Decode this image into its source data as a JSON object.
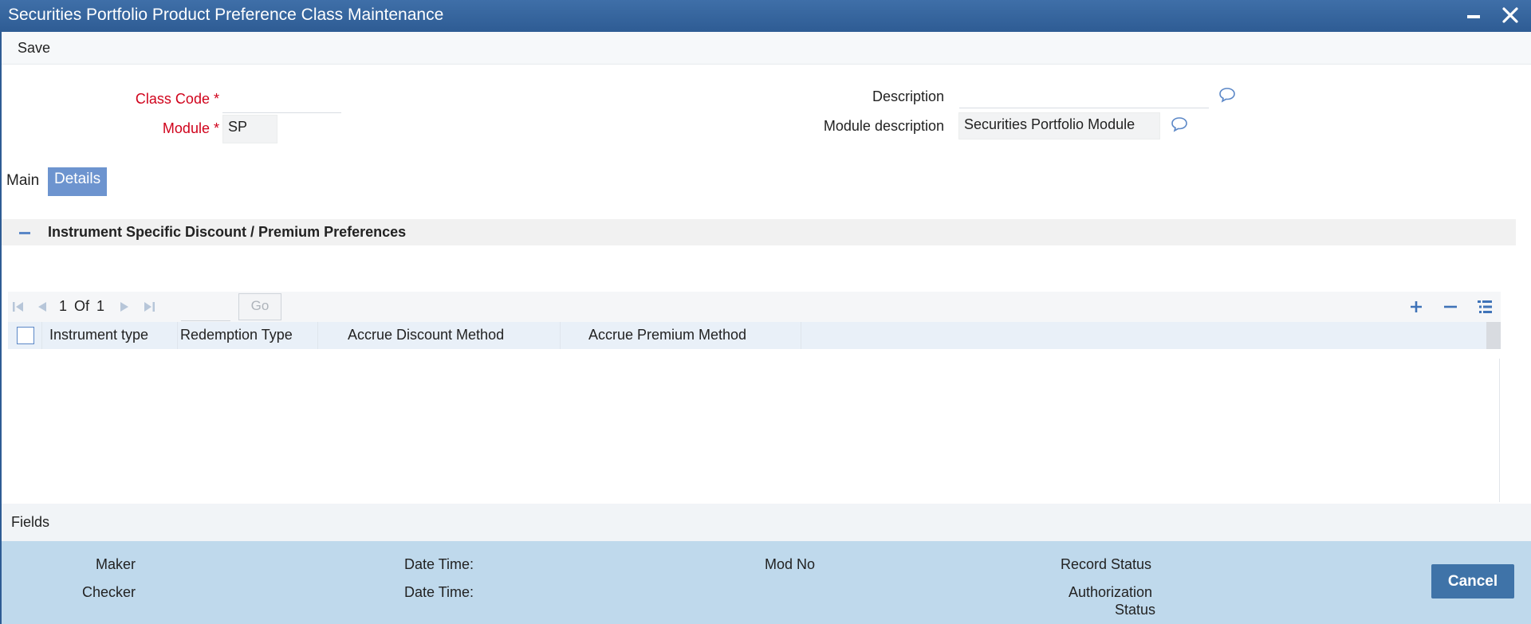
{
  "window": {
    "title": "Securities Portfolio Product Preference Class Maintenance"
  },
  "toolbar": {
    "save_label": "Save"
  },
  "form": {
    "class_code_label": "Class Code",
    "class_code_value": "",
    "module_label": "Module",
    "module_value": "SP",
    "required_marker": "*",
    "description_label": "Description",
    "description_value": "",
    "module_description_label": "Module description",
    "module_description_value": "Securities Portfolio Module"
  },
  "tabs": [
    {
      "label": "Main",
      "active": false
    },
    {
      "label": "Details",
      "active": true
    }
  ],
  "section": {
    "title": "Instrument Specific Discount / Premium Preferences"
  },
  "grid": {
    "pager": {
      "current": "1",
      "of_label": "Of",
      "total": "1"
    },
    "go_label": "Go",
    "columns": [
      "Instrument type",
      "Redemption Type",
      "Accrue Discount Method",
      "Accrue Premium Method"
    ],
    "rows": []
  },
  "fields_bar": {
    "label": "Fields"
  },
  "audit": {
    "maker_label": "Maker",
    "checker_label": "Checker",
    "date_time_label": "Date Time:",
    "mod_no_label": "Mod No",
    "record_status_label": "Record Status",
    "auth_status_line1": "Authorization",
    "auth_status_line2": "Status",
    "cancel_label": "Cancel"
  },
  "colors": {
    "title_bar": "#2e5c94",
    "required": "#d0021b",
    "active_tab": "#6d94cf",
    "accent_icon": "#5b87c7",
    "audit_panel": "#bfd9ec",
    "cancel_button": "#3f73a8"
  },
  "icons": {
    "window_minimize": "minimize-icon",
    "window_close": "close-icon",
    "lov": "speech-bubble-icon",
    "section_toggle": "minus-icon",
    "pager_first": "first-page-icon",
    "pager_prev": "previous-page-icon",
    "pager_next": "next-page-icon",
    "pager_last": "last-page-icon",
    "grid_add": "plus-icon",
    "grid_remove": "minus-icon",
    "grid_view": "single-view-icon"
  }
}
